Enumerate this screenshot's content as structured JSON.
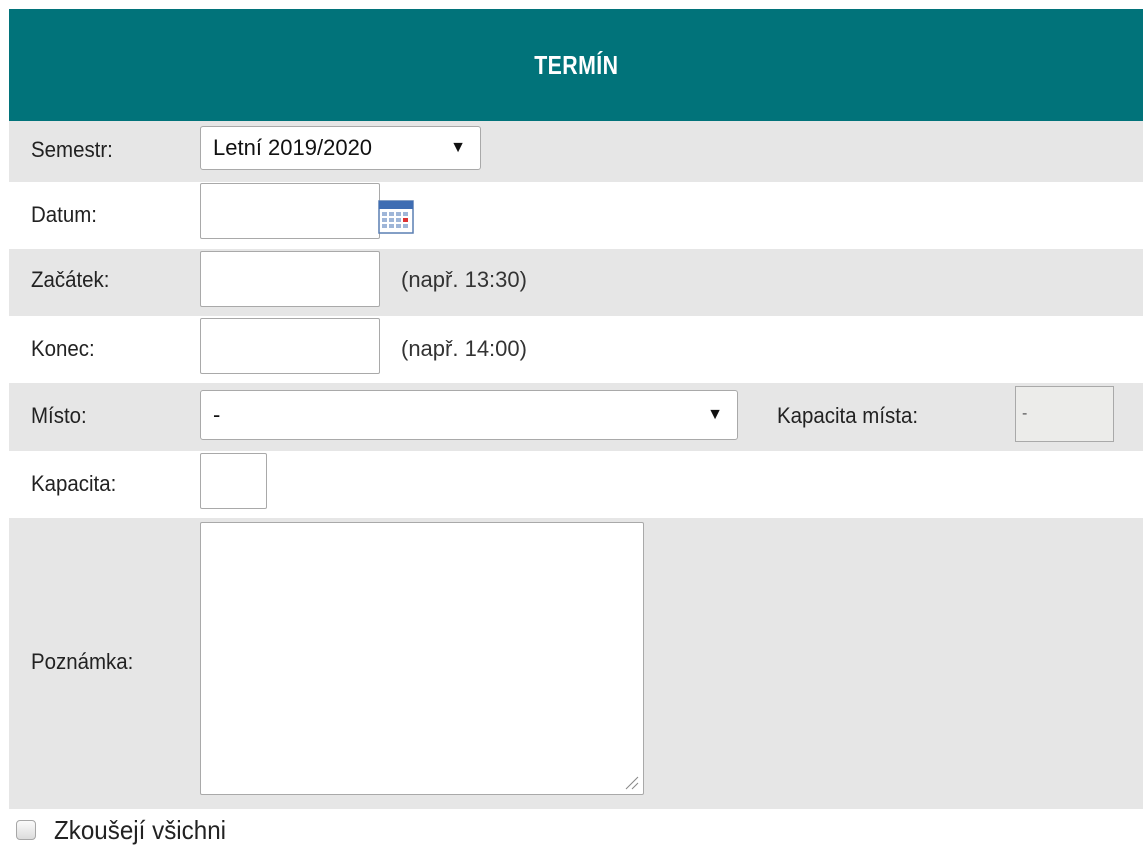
{
  "header": {
    "title": "TERMÍN"
  },
  "form": {
    "semestr": {
      "label": "Semestr:",
      "selected": "Letní 2019/2020"
    },
    "datum": {
      "label": "Datum:",
      "value": ""
    },
    "zacatek": {
      "label": "Začátek:",
      "value": "",
      "hint": "(např. 13:30)"
    },
    "konec": {
      "label": "Konec:",
      "value": "",
      "hint": "(např. 14:00)"
    },
    "misto": {
      "label": "Místo:",
      "selected": "-",
      "capacity_label": "Kapacita místa:",
      "capacity_value": "-"
    },
    "kapacita": {
      "label": "Kapacita:",
      "value": ""
    },
    "poznamka": {
      "label": "Poznámka:",
      "value": ""
    },
    "zkouseji_vsichni": {
      "label": "Zkoušejí všichni",
      "checked": false
    }
  },
  "icons": {
    "calendar": "calendar-icon",
    "dropdown_arrow": "triangle-down"
  },
  "colors": {
    "header_bg": "#01737a",
    "row_gray": "#e6e6e6",
    "header_text": "#ffffff"
  }
}
